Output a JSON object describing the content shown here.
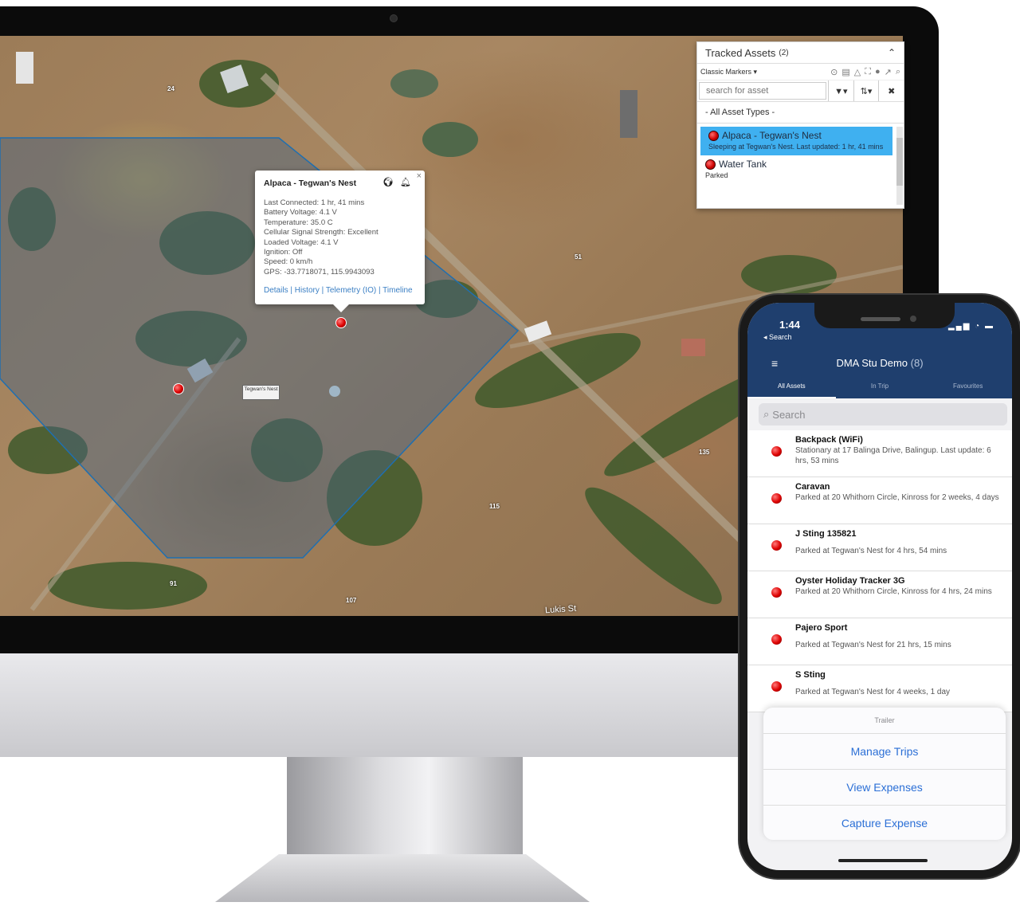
{
  "desktop": {
    "panel": {
      "title": "Tracked Assets",
      "count": "(2)",
      "marker_style": "Classic Markers ▾",
      "search_placeholder": "search for asset",
      "filter_label": "▼▾",
      "sort_label": "⇅▾",
      "clear_label": "✖",
      "asset_type": "- All Asset Types -",
      "assets": [
        {
          "name": "Alpaca - Tegwan's Nest",
          "desc": "Sleeping at Tegwan's Nest. Last updated: 1 hr, 41 mins"
        },
        {
          "name": "Water Tank",
          "desc": "Parked"
        }
      ]
    },
    "popup": {
      "title": "Alpaca - Tegwan's Nest",
      "lines": [
        "Last Connected: 1 hr, 41 mins",
        "Battery Voltage: 4.1 V",
        "Temperature: 35.0 C",
        "Cellular Signal Strength: Excellent",
        "Loaded Voltage: 4.1 V",
        "Ignition: Off",
        "Speed: 0 km/h",
        "GPS: -33.7718071, 115.9943093"
      ],
      "links": [
        "Details",
        "History",
        "Telemetry (IO)",
        "Timeline"
      ],
      "close": "×"
    },
    "map": {
      "place_label": "Tegwan's Nest",
      "street": "Lukis St",
      "road_numbers": [
        "24",
        "51",
        "135",
        "115",
        "91",
        "107"
      ]
    }
  },
  "phone": {
    "time": "1:44",
    "back": "◂ Search",
    "title": "DMA Stu Demo",
    "count": "(8)",
    "tabs": [
      "All Assets",
      "In Trip",
      "Favourites"
    ],
    "search_placeholder": "Search",
    "assets": [
      {
        "name": "Backpack (WiFi)",
        "status": "Stationary at 17 Balinga Drive, Balingup. Last update: 6 hrs, 53 mins"
      },
      {
        "name": "Caravan",
        "status": "Parked at 20 Whithorn Circle, Kinross for 2 weeks, 4 days"
      },
      {
        "name": "J Sting 135821",
        "status": "Parked at Tegwan's Nest for 4 hrs, 54 mins"
      },
      {
        "name": "Oyster Holiday Tracker 3G",
        "status": "Parked at 20 Whithorn Circle, Kinross for 4 hrs, 24 mins"
      },
      {
        "name": "Pajero Sport",
        "status": "Parked at Tegwan's Nest for 21 hrs, 15 mins"
      },
      {
        "name": "S Sting",
        "status": "Parked at Tegwan's Nest for 4 weeks, 1 day"
      }
    ],
    "sheet": {
      "title": "Trailer",
      "actions": [
        "Manage Trips",
        "View Expenses",
        "Capture Expense"
      ]
    }
  },
  "colors": {
    "accent": "#1f3f6e",
    "selected": "#3fb0f0",
    "link": "#2b6fd6",
    "marker": "#dd0000"
  }
}
